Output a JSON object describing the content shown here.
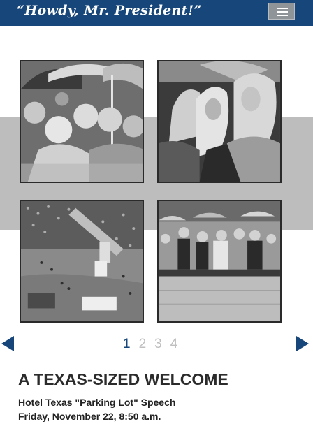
{
  "header": {
    "logo_text": "“Howdy, Mr. President!”",
    "menu_icon": "hamburger-menu-icon"
  },
  "gallery": {
    "photos": [
      {
        "name": "crowd-women-umbrellas"
      },
      {
        "name": "women-headscarves-rain"
      },
      {
        "name": "aerial-motorcade-crowd"
      },
      {
        "name": "crowd-barrier-rain"
      }
    ],
    "pages": [
      "1",
      "2",
      "3",
      "4"
    ],
    "current_page": "1",
    "prev_icon": "arrow-left-icon",
    "next_icon": "arrow-right-icon"
  },
  "article": {
    "title": "A TEXAS-SIZED WELCOME",
    "subtitle": "Hotel Texas \"Parking Lot\" Speech",
    "date": "Friday, November 22, 8:50 a.m."
  },
  "colors": {
    "header_bg": "#16467a",
    "accent": "#16467a",
    "band": "#bdbdbd",
    "inactive_page": "#bfbfbf"
  }
}
